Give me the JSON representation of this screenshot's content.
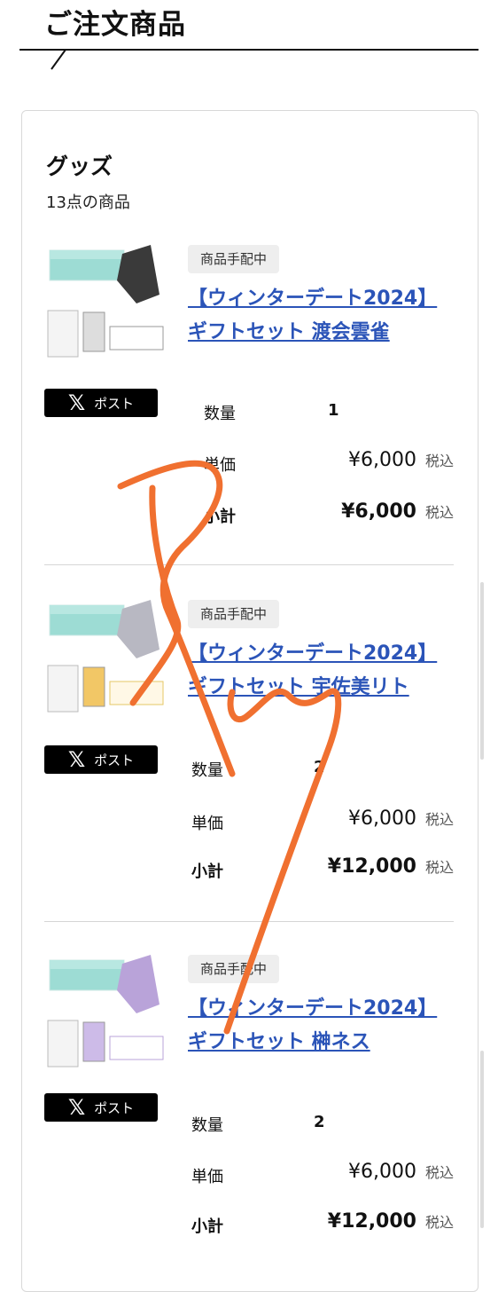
{
  "section": {
    "title": "ご注文商品"
  },
  "category": {
    "title": "グッズ",
    "count_text": "13点の商品"
  },
  "labels": {
    "qty": "数量",
    "unit": "単価",
    "subtotal": "小計",
    "tax": "税込",
    "post": "ポスト"
  },
  "items": [
    {
      "badge": "商品手配中",
      "name_line1": "【ウィンターデート2024】",
      "name_line2": "ギフトセット 渡会雲雀",
      "qty": "1",
      "unit_price": "¥6,000",
      "subtotal": "¥6,000",
      "scarf_color": "#3a3a3a"
    },
    {
      "badge": "商品手配中",
      "name_line1": "【ウィンターデート2024】",
      "name_line2": "ギフトセット 宇佐美リト",
      "qty": "2",
      "unit_price": "¥6,000",
      "subtotal": "¥12,000",
      "scarf_color": "#b8b8c2"
    },
    {
      "badge": "商品手配中",
      "name_line1": "【ウィンターデート2024】",
      "name_line2": "ギフトセット 榊ネス",
      "qty": "2",
      "unit_price": "¥6,000",
      "subtotal": "¥12,000",
      "scarf_color": "#b9a3d9"
    }
  ],
  "colors": {
    "link": "#2b54b8",
    "scribble": "#f07030"
  }
}
